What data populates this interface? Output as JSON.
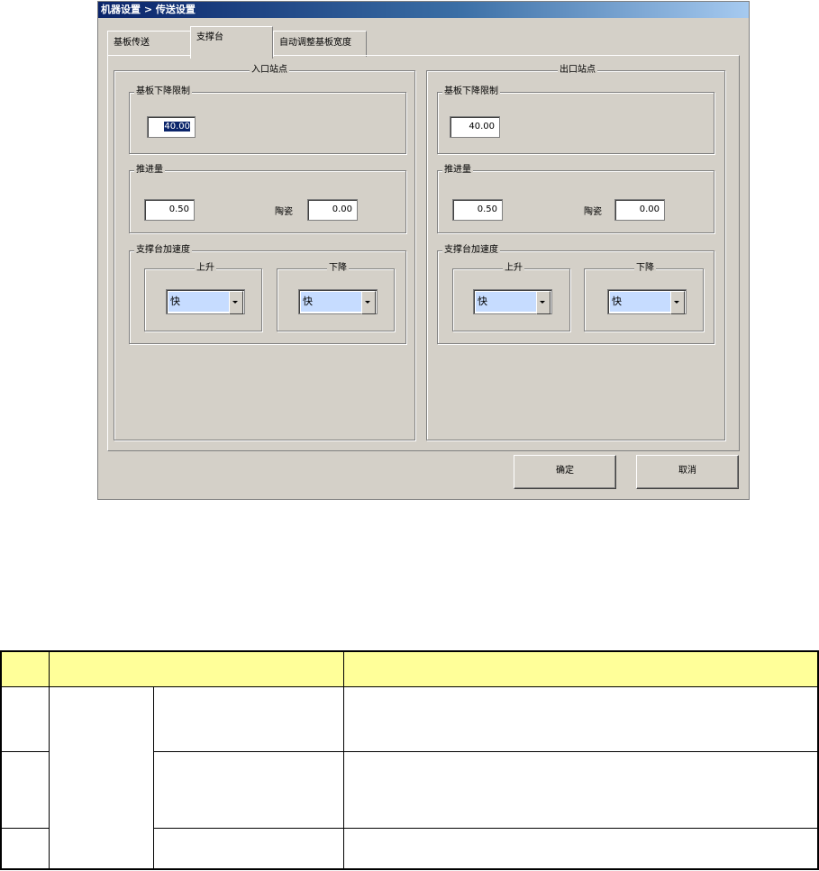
{
  "window": {
    "title": "机器设置 > 传送设置"
  },
  "tabs": [
    {
      "label": "基板传送",
      "active": false
    },
    {
      "label": "支撑台",
      "active": true
    },
    {
      "label": "自动调整基板宽度",
      "active": false
    }
  ],
  "entry": {
    "title": "入口站点",
    "lower_limit": {
      "label": "基板下降限制",
      "value": "40.00"
    },
    "push": {
      "label": "推进量",
      "value": "0.50",
      "ceramic_label": "陶瓷",
      "ceramic_value": "0.00"
    },
    "accel": {
      "label": "支撑台加速度",
      "up_label": "上升",
      "up_value": "快",
      "down_label": "下降",
      "down_value": "快"
    }
  },
  "exit": {
    "title": "出口站点",
    "lower_limit": {
      "label": "基板下降限制",
      "value": "40.00"
    },
    "push": {
      "label": "推进量",
      "value": "0.50",
      "ceramic_label": "陶瓷",
      "ceramic_value": "0.00"
    },
    "accel": {
      "label": "支撑台加速度",
      "up_label": "上升",
      "up_value": "快",
      "down_label": "下降",
      "down_value": "快"
    }
  },
  "buttons": {
    "ok": "确定",
    "cancel": "取消"
  },
  "colors": {
    "window_bg": "#d4d0c8",
    "title_start": "#0a246a",
    "table_header": "#ffff99",
    "combo_fill": "#c6dcff"
  }
}
